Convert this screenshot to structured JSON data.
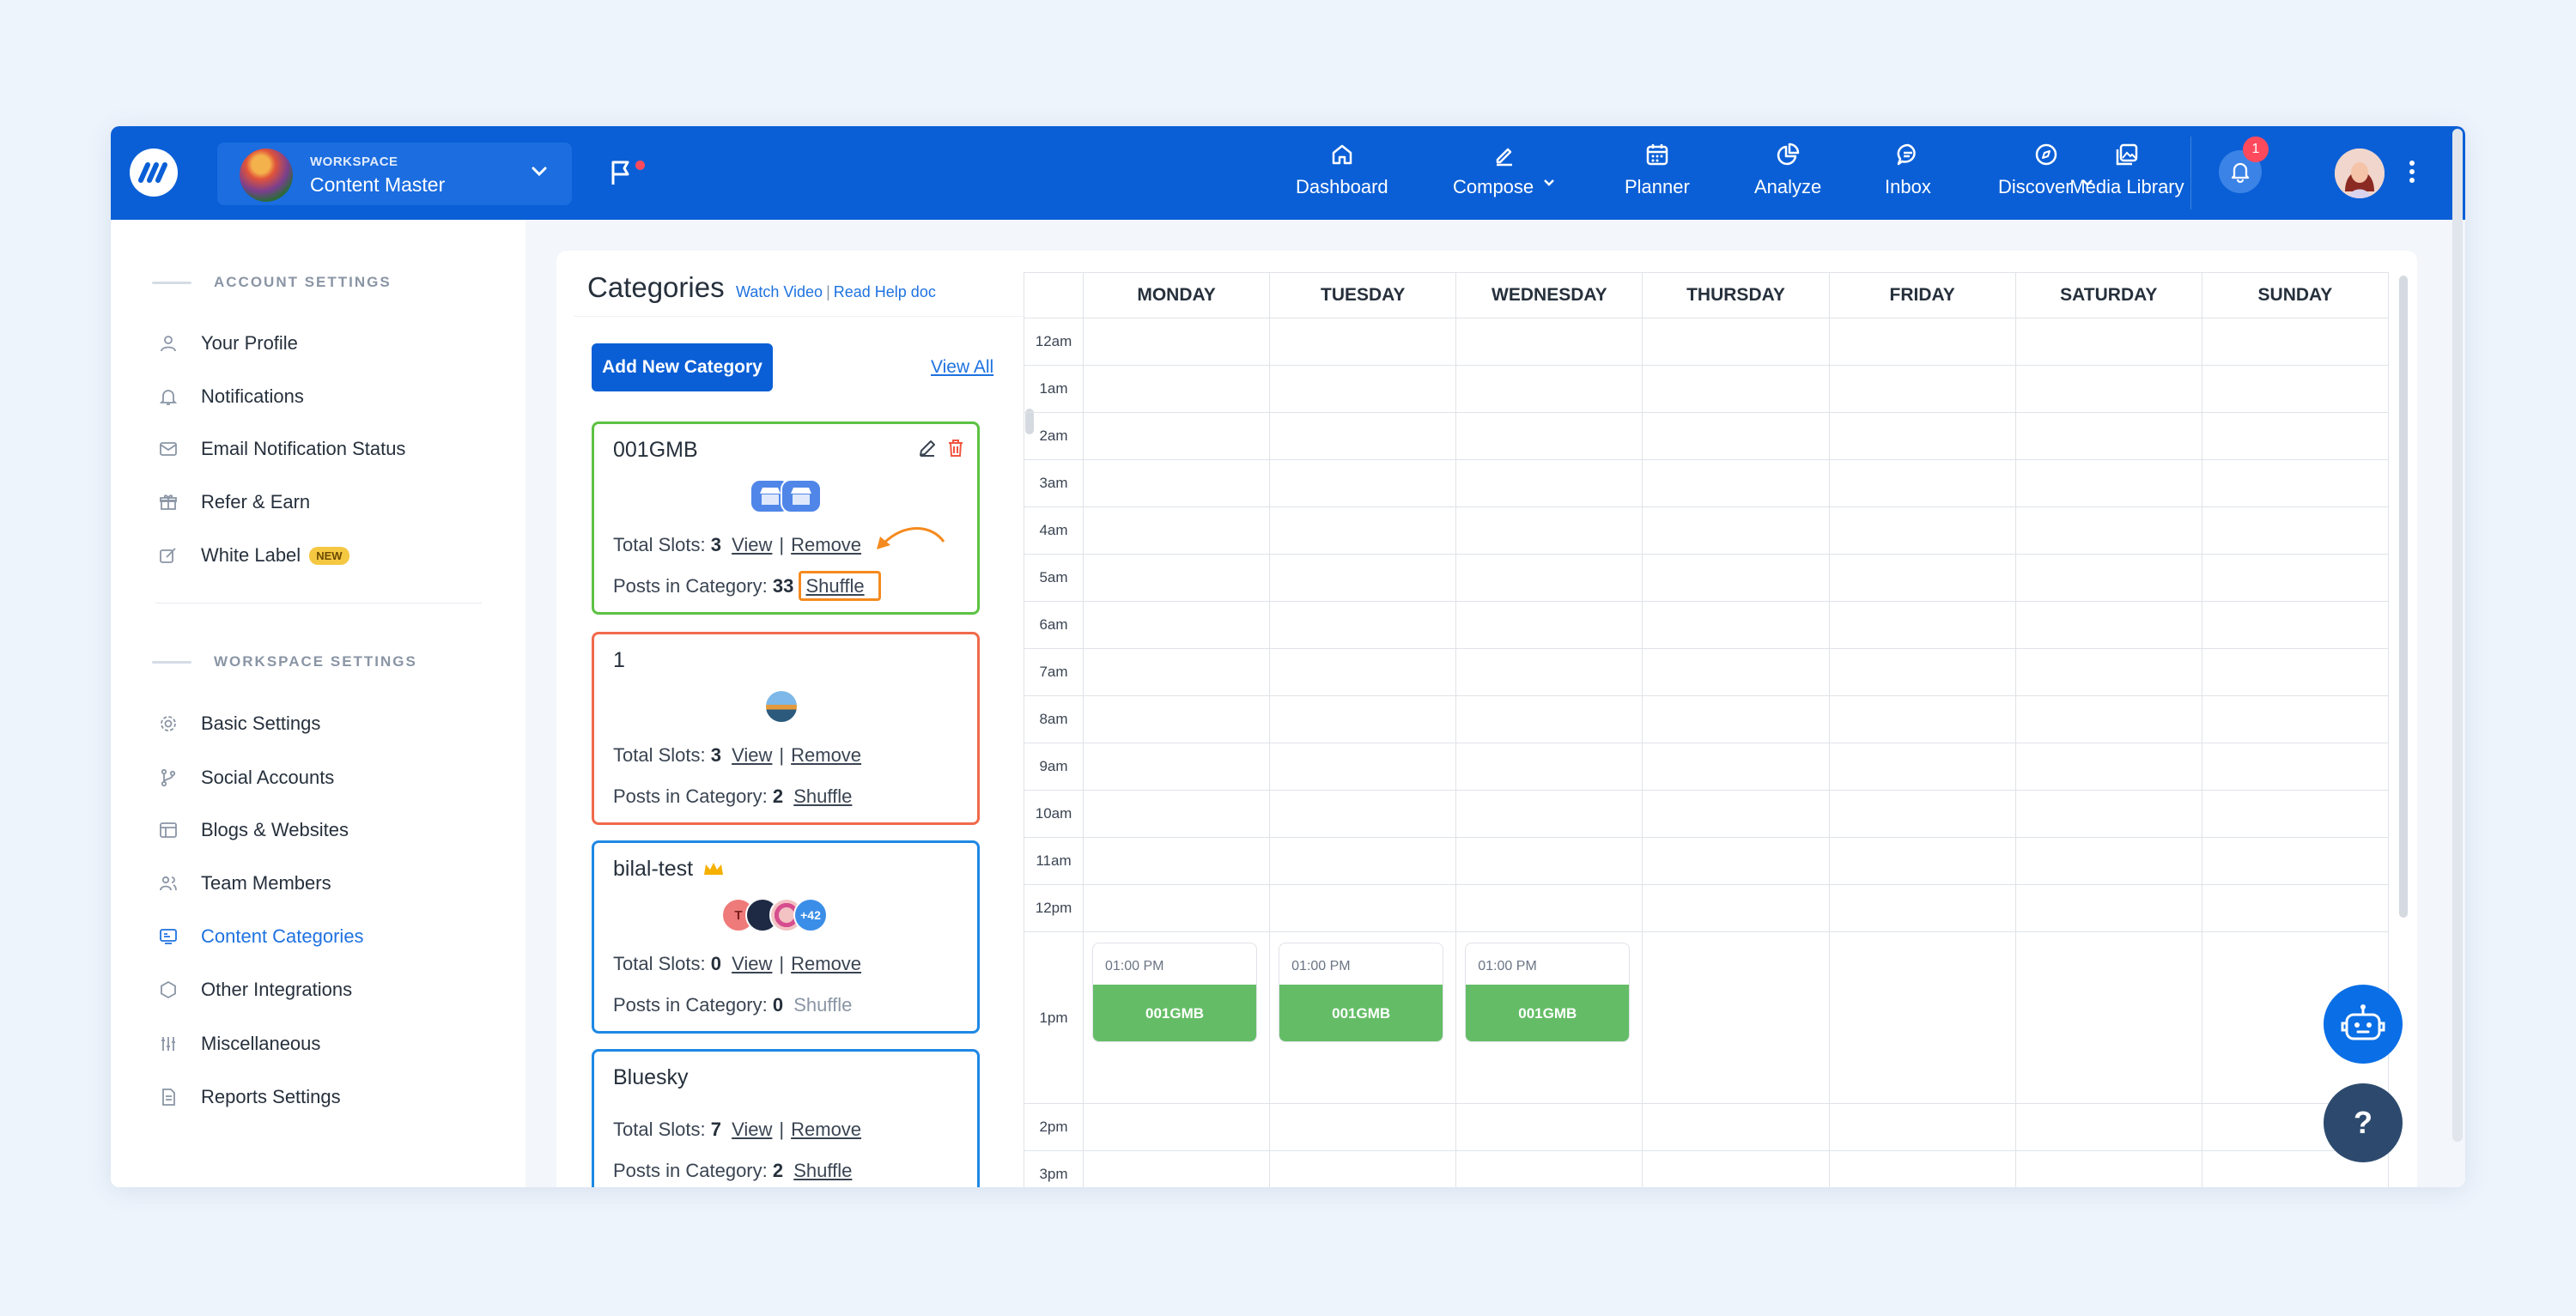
{
  "workspace": {
    "label": "WORKSPACE",
    "name": "Content Master"
  },
  "nav": {
    "dashboard": "Dashboard",
    "compose": "Compose",
    "planner": "Planner",
    "analyze": "Analyze",
    "inbox": "Inbox",
    "discover": "Discover",
    "media": "Media Library",
    "notification_count": "1"
  },
  "sidebar": {
    "account_heading": "ACCOUNT SETTINGS",
    "account_items": [
      "Your Profile",
      "Notifications",
      "Email Notification Status",
      "Refer & Earn",
      "White Label"
    ],
    "new_badge": "NEW",
    "workspace_heading": "WORKSPACE SETTINGS",
    "workspace_items": [
      "Basic Settings",
      "Social Accounts",
      "Blogs & Websites",
      "Team Members",
      "Content Categories",
      "Other Integrations",
      "Miscellaneous",
      "Reports Settings"
    ]
  },
  "categories": {
    "title": "Categories",
    "watch_video": "Watch Video",
    "pipe": "|",
    "read_help": "Read Help doc",
    "add_button": "Add New Category",
    "view_all": "View All",
    "total_slots_label": "Total Slots:",
    "posts_label": "Posts in Category:",
    "view": "View",
    "remove": "Remove",
    "shuffle": "Shuffle",
    "more_count": "+42",
    "t_letter": "T",
    "items": [
      {
        "name": "001GMB",
        "slots": "3",
        "posts": "33",
        "color": "#5cc244"
      },
      {
        "name": "1",
        "slots": "3",
        "posts": "2",
        "color": "#f06a4b"
      },
      {
        "name": "bilal-test",
        "slots": "0",
        "posts": "0",
        "color": "#1e88e5"
      },
      {
        "name": "Bluesky",
        "slots": "7",
        "posts": "2",
        "color": "#1e88e5"
      }
    ]
  },
  "calendar": {
    "days": [
      "MONDAY",
      "TUESDAY",
      "WEDNESDAY",
      "THURSDAY",
      "FRIDAY",
      "SATURDAY",
      "SUNDAY"
    ],
    "hours": [
      "12am",
      "1am",
      "2am",
      "3am",
      "4am",
      "5am",
      "6am",
      "7am",
      "8am",
      "9am",
      "10am",
      "11am",
      "12pm",
      "1pm",
      "2pm",
      "3pm"
    ],
    "slot_time": "01:00 PM",
    "slot_label": "001GMB"
  },
  "help": "?"
}
